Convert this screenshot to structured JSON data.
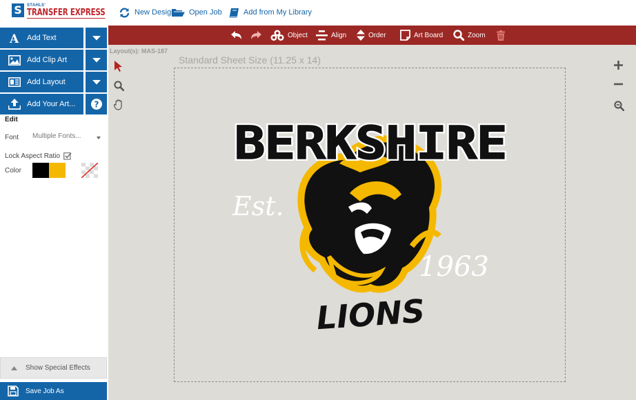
{
  "header": {
    "logo_small": "STAHLS'",
    "logo_main": "TRANSFER EXPRESS",
    "logo_mark": "S",
    "nav": [
      {
        "label": "New Design",
        "icon": "refresh-icon"
      },
      {
        "label": "Open Job",
        "icon": "folder-open-icon"
      },
      {
        "label": "Add from My Library",
        "icon": "book-icon"
      }
    ]
  },
  "sidebar": {
    "tools": [
      {
        "label": "Add Text",
        "icon": "text-icon",
        "side_icon": "caret-down-icon"
      },
      {
        "label": "Add Clip Art",
        "icon": "image-icon",
        "side_icon": "caret-down-icon"
      },
      {
        "label": "Add Layout",
        "icon": "layout-icon",
        "side_icon": "caret-down-icon"
      },
      {
        "label": "Add Your Art...",
        "icon": "upload-icon",
        "side_icon": "help-icon"
      }
    ],
    "edit": {
      "title": "Edit",
      "font_label": "Font",
      "font_value": "Multiple Fonts...",
      "lock_label": "Lock Aspect Ratio",
      "lock_checked": true,
      "color_label": "Color",
      "swatches": [
        "#000000",
        "#f5b800",
        "#ffffff",
        "transparent"
      ]
    },
    "special_effects_label": "Show Special Effects",
    "save_label": "Save Job As"
  },
  "toolbar": {
    "items": [
      {
        "label": "",
        "icon": "undo-icon"
      },
      {
        "label": "",
        "icon": "redo-icon"
      },
      {
        "label": "Object",
        "icon": "objects-icon"
      },
      {
        "label": "Align",
        "icon": "align-icon"
      },
      {
        "label": "Order",
        "icon": "order-icon"
      },
      {
        "label": "Art Board",
        "icon": "artboard-icon"
      },
      {
        "label": "Zoom",
        "icon": "zoom-icon"
      },
      {
        "label": "",
        "icon": "trash-icon"
      }
    ],
    "bg_color": "#9c2825"
  },
  "canvas": {
    "layout_label": "Layout(s): MAS-187",
    "sheet_label": "Standard Sheet Size (11.25 x 14)",
    "left_tools": [
      "pointer-icon",
      "magnifier-icon",
      "hand-icon"
    ],
    "right_tools": [
      "zoom-in-icon",
      "zoom-out-icon",
      "zoom-fit-icon"
    ],
    "background": "#dedcd7"
  },
  "artwork": {
    "title": "BERKSHIRE",
    "est": "Est.",
    "year": "1963",
    "subtitle": "LIONS",
    "colors": {
      "black": "#111111",
      "gold": "#f5b800",
      "white": "#ffffff"
    }
  }
}
